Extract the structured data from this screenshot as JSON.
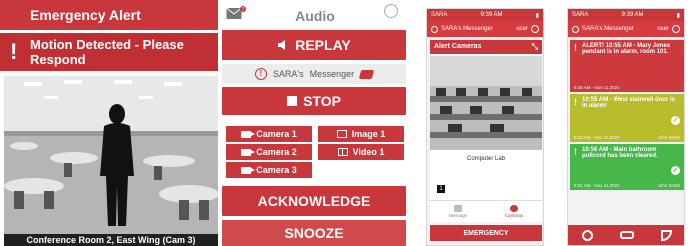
{
  "left_panel": {
    "alert_title": "Emergency Alert",
    "alert_message": "Motion Detected - Please Respond",
    "audio_label": "Audio",
    "mail_badge": "7",
    "replay_label": "REPLAY",
    "brand_prefix": "SARA's",
    "brand_suffix": "Messenger",
    "stop_label": "STOP",
    "camera_buttons": [
      "Camera 1",
      "Camera 2",
      "Camera 3"
    ],
    "image_label": "Image 1",
    "video_label": "Video 1",
    "acknowledge_label": "ACKNOWLEDGE",
    "snooze_label": "SNOOZE",
    "camera_caption": "Conference Room 2, East Wing (Cam 3)"
  },
  "phone1": {
    "status_time": "9:39 AM",
    "status_left": "SARA",
    "app_title": "SARA's Messenger",
    "app_user": "user",
    "card_title": "Alert Cameras",
    "camera_caption": "Computer Lab",
    "camera_count": "1",
    "tabs": [
      "Message",
      "Cameras"
    ],
    "emergency_label": "EMERGENCY"
  },
  "phone2": {
    "status_time": "9:39 AM",
    "status_left": "SARA",
    "app_title": "SARA's Messenger",
    "app_user": "user",
    "messages": [
      {
        "text": "ALERT! 10:55 AM - Mary Jones pendant is in alarm, room 101.",
        "date": "9:38 AM - Nov 11,2021",
        "by": ""
      },
      {
        "text": "10:55 AM - West stairwell door is in alarm!",
        "date": "9:33 AM - Nov 11,2021",
        "by": "John Smith"
      },
      {
        "text": "10:56 AM - Main bathroom pullcord has been cleared.",
        "date": "9:31 AM - Nov 11,2021",
        "by": "John Smith"
      }
    ]
  },
  "colors": {
    "brand_red": "#c8373b",
    "alert_yellow": "#b9bd2c",
    "cleared_green": "#46b84a"
  }
}
